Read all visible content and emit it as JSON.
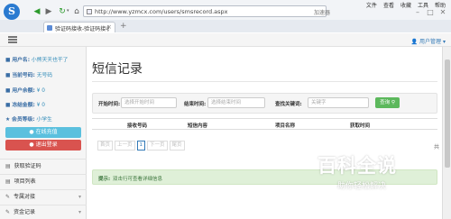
{
  "browser": {
    "logo_glyph": "S",
    "url": "http://www.yzmcx.com/users/smsrecord.aspx",
    "accelerate_label": "加速器",
    "menu": [
      "文件",
      "查看",
      "收藏",
      "工具",
      "帮助"
    ],
    "tab_title": "验证码接收-验证码接收平台",
    "new_tab": "+",
    "close_tab": "×"
  },
  "header": {
    "user_menu": "用户管理"
  },
  "sidebar": {
    "username_label": "用户名:",
    "username_value": "小熊天天也干了",
    "phone_label": "当前号码:",
    "phone_value": "无号码",
    "balance_label": "用户余额:",
    "balance_value": "¥ 0",
    "frozen_label": "冻结金额:",
    "frozen_value": "¥ 0",
    "level_label": "会员等级:",
    "level_value": "小学生",
    "online_button": "在线充值",
    "logout_button": "退出登录",
    "nav": [
      {
        "label": "获取验证码",
        "has_caret": false
      },
      {
        "label": "项目列表",
        "has_caret": false
      },
      {
        "label": "专属对接",
        "has_caret": true
      },
      {
        "label": "资金记录",
        "has_caret": true
      }
    ]
  },
  "main": {
    "title": "短信记录",
    "filters": {
      "start_label": "开始时间:",
      "start_placeholder": "选择开始时间",
      "end_label": "结束时间:",
      "end_placeholder": "选择结束时间",
      "keyword_label": "查找关键词:",
      "keyword_placeholder": "关键字",
      "search_button": "查询"
    },
    "table_headers": [
      "接收号码",
      "短信内容",
      "项目名称",
      "获取时间"
    ],
    "pager": [
      "首页",
      "上一页",
      "1",
      "下一页",
      "尾页"
    ],
    "pager_end": "共",
    "alert_label": "提示:",
    "alert_text": "双击行可查看详细信息"
  },
  "watermark": {
    "title": "百科全说",
    "subtitle": "助你轻松解决"
  },
  "colors": {
    "accent": "#337ab7",
    "online_button": "#5bc0de",
    "logout_button": "#d9534f",
    "search_button": "#5cb85c",
    "alert_bg": "#dff0d8"
  }
}
